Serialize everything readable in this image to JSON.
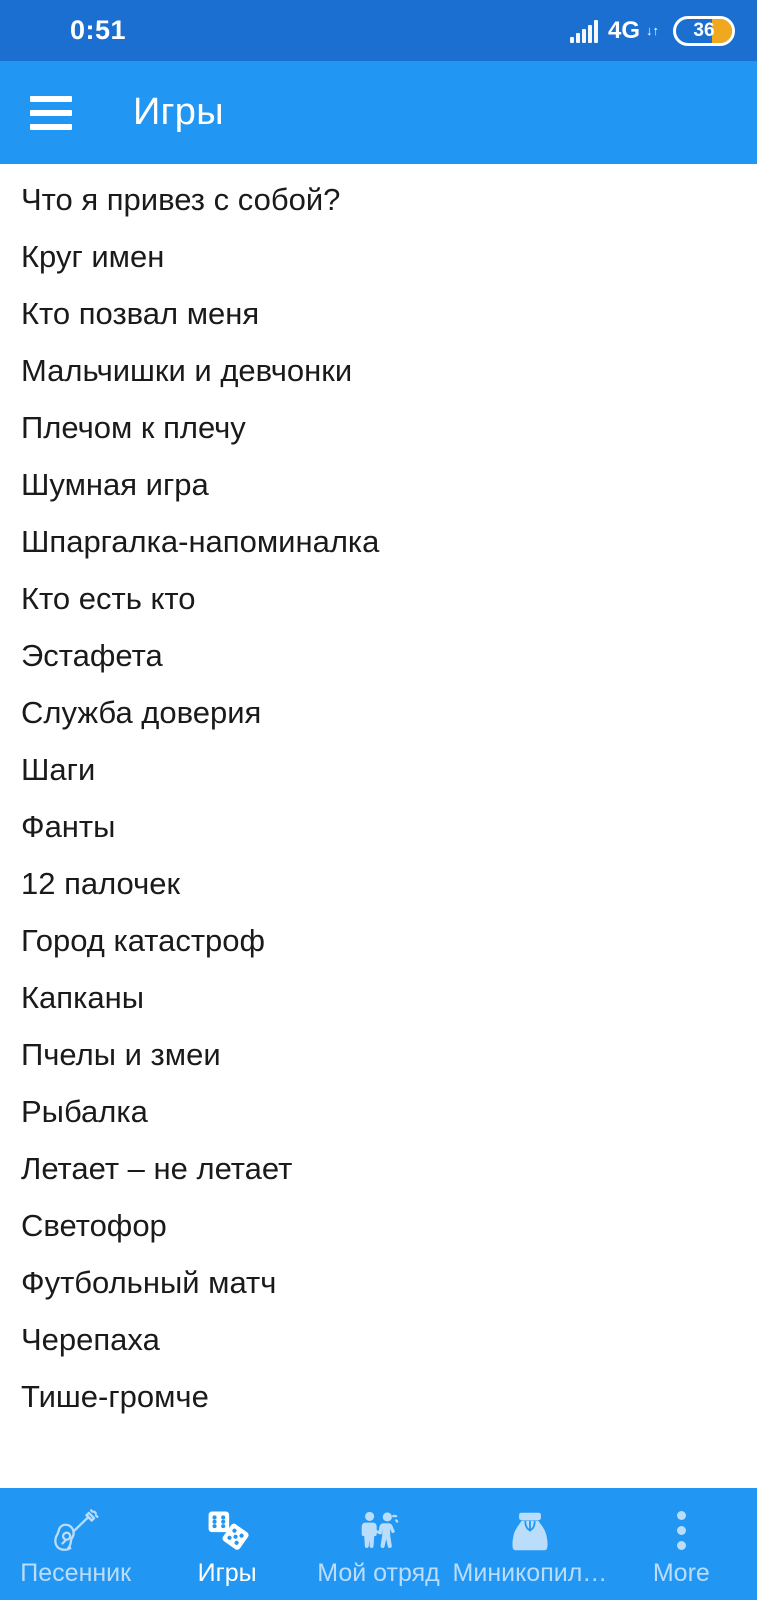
{
  "status_bar": {
    "time": "0:51",
    "network_type": "4G",
    "network_arrows": "↓↑",
    "battery_level": "36",
    "signal_icon": "signal-bars-icon",
    "battery_fill_color": "#f0a81e",
    "background_color": "#1a6fd0"
  },
  "app_bar": {
    "menu_icon": "hamburger-menu-icon",
    "title": "Игры",
    "background_color": "#2196f3"
  },
  "list": {
    "items": [
      {
        "label": "Что я привез с собой?"
      },
      {
        "label": "Круг имен"
      },
      {
        "label": "Кто позвал меня"
      },
      {
        "label": "Мальчишки и девчонки"
      },
      {
        "label": "Плечом к плечу"
      },
      {
        "label": "Шумная игра"
      },
      {
        "label": "Шпаргалка-напоминалка"
      },
      {
        "label": "Кто есть кто"
      },
      {
        "label": "Эстафета"
      },
      {
        "label": "Служба доверия"
      },
      {
        "label": "Шаги"
      },
      {
        "label": "Фанты"
      },
      {
        "label": "12 палочек"
      },
      {
        "label": "Город катастроф"
      },
      {
        "label": "Капканы"
      },
      {
        "label": "Пчелы и змеи"
      },
      {
        "label": "Рыбалка"
      },
      {
        "label": "Летает – не летает"
      },
      {
        "label": "Светофор"
      },
      {
        "label": "Футбольный матч"
      },
      {
        "label": "Черепаха"
      },
      {
        "label": "Тише-громче"
      }
    ]
  },
  "bottom_nav": {
    "background_color": "#2196f3",
    "active_color": "#ffffff",
    "inactive_color": "#b9ddfb",
    "items": [
      {
        "label": "Песенник",
        "icon": "guitar-icon",
        "active": false
      },
      {
        "label": "Игры",
        "icon": "dice-icon",
        "active": true
      },
      {
        "label": "Мой отряд",
        "icon": "two-children-icon",
        "active": false
      },
      {
        "label": "Миникопил…",
        "icon": "money-bag-icon",
        "active": false
      },
      {
        "label": "More",
        "icon": "overflow-dots-icon",
        "active": false
      }
    ]
  }
}
